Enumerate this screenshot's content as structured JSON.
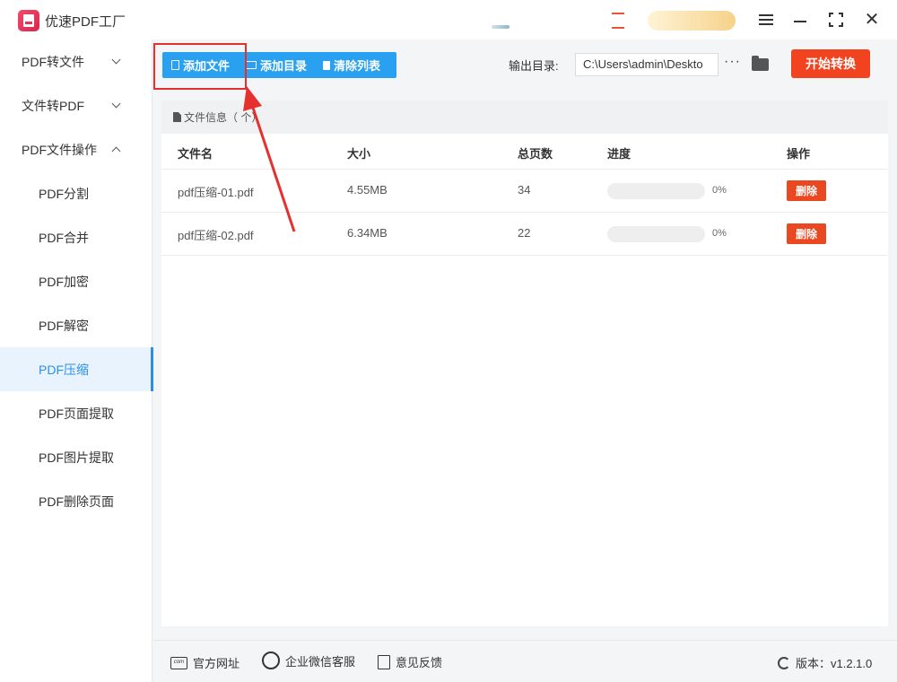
{
  "app": {
    "title": "优速PDF工厂"
  },
  "sidebar": {
    "items": [
      {
        "label": "PDF转文件",
        "type": "group",
        "expanded": false
      },
      {
        "label": "文件转PDF",
        "type": "group",
        "expanded": false
      },
      {
        "label": "PDF文件操作",
        "type": "group",
        "expanded": true
      },
      {
        "label": "PDF分割",
        "type": "sub"
      },
      {
        "label": "PDF合并",
        "type": "sub"
      },
      {
        "label": "PDF加密",
        "type": "sub"
      },
      {
        "label": "PDF解密",
        "type": "sub"
      },
      {
        "label": "PDF压缩",
        "type": "sub",
        "active": true
      },
      {
        "label": "PDF页面提取",
        "type": "sub"
      },
      {
        "label": "PDF图片提取",
        "type": "sub"
      },
      {
        "label": "PDF删除页面",
        "type": "sub"
      }
    ]
  },
  "toolbar": {
    "add_file": "添加文件",
    "add_folder": "添加目录",
    "clear_list": "清除列表",
    "output_label": "输出目录:",
    "output_path": "C:\\Users\\admin\\Deskto",
    "more": "···",
    "start": "开始转换"
  },
  "panel": {
    "header": "文件信息（ 个）",
    "columns": {
      "name": "文件名",
      "size": "大小",
      "pages": "总页数",
      "progress": "进度",
      "action": "操作"
    },
    "rows": [
      {
        "name": "pdf压缩-01.pdf",
        "size": "4.55MB",
        "pages": "34",
        "progress_pct": "0%",
        "progress": 0,
        "action": "删除"
      },
      {
        "name": "pdf压缩-02.pdf",
        "size": "6.34MB",
        "pages": "22",
        "progress_pct": "0%",
        "progress": 0,
        "action": "删除"
      }
    ]
  },
  "footer": {
    "website": "官方网址",
    "wechat": "企业微信客服",
    "feedback": "意见反馈",
    "version": "版本：v1.2.1.0",
    "web_icon_text": "com"
  },
  "colors": {
    "accent": "#2aa1f0",
    "start_button": "#f1431f",
    "delete_button": "#e94820",
    "annotation": "#e5312e",
    "active_sidebar": "#2b8fe8"
  }
}
